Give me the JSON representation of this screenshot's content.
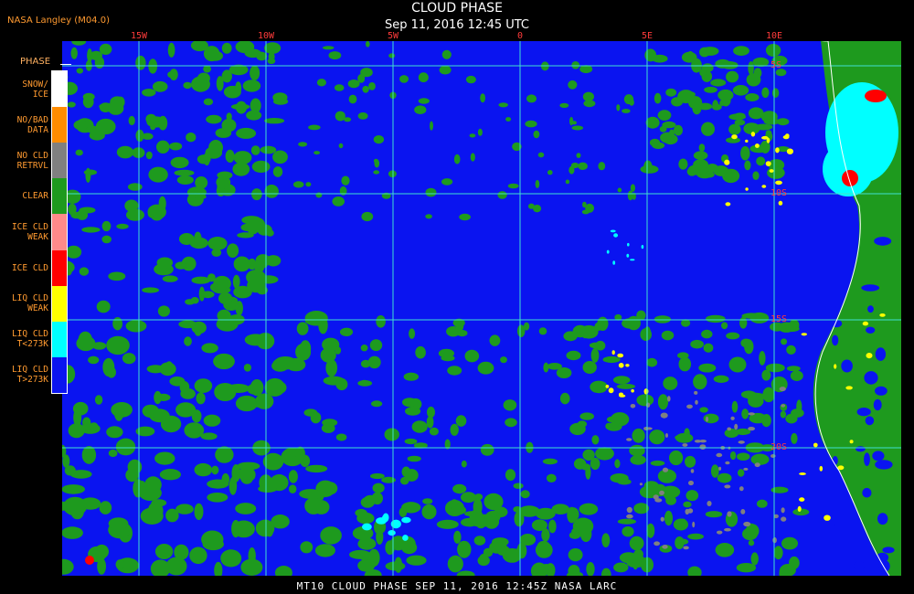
{
  "header": {
    "title": "CLOUD PHASE",
    "subtitle": "Sep 11, 2016 12:45 UTC",
    "credit": "NASA Langley (M04.0)"
  },
  "map": {
    "lon_labels": [
      "15W",
      "10W",
      "5W",
      "0",
      "5E",
      "10E"
    ],
    "lat_labels": [
      "5S",
      "10S",
      "15S",
      "20S"
    ],
    "colors": {
      "grid": "#40e0d0",
      "coast": "#ffffff",
      "label": "#ff3b3b"
    }
  },
  "legend": {
    "title": "PHASE",
    "items": [
      {
        "label": "SNOW/\nICE",
        "color": "#ffffff"
      },
      {
        "label": "NO/BAD\nDATA",
        "color": "#ff8c00"
      },
      {
        "label": "NO CLD\nRETRVL",
        "color": "#808080"
      },
      {
        "label": "CLEAR",
        "color": "#1e9a1e"
      },
      {
        "label": "ICE CLD\nWEAK",
        "color": "#ff8a8a"
      },
      {
        "label": "ICE CLD",
        "color": "#ff0000"
      },
      {
        "label": "LIQ CLD\nWEAK",
        "color": "#ffff00"
      },
      {
        "label": "LIQ CLD\nT<273K",
        "color": "#00ffff"
      },
      {
        "label": "LIQ CLD\nT>273K",
        "color": "#0a14f0"
      }
    ]
  },
  "footer": {
    "text": "MT10  CLOUD PHASE  SEP 11, 2016 12:45Z  NASA LARC"
  }
}
